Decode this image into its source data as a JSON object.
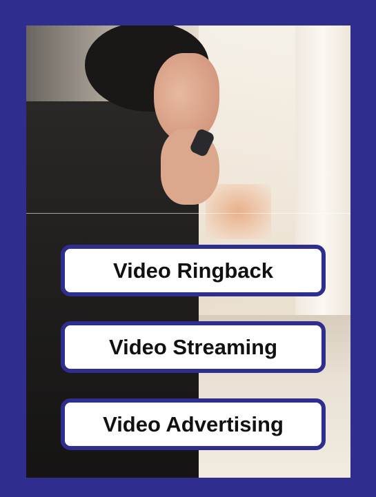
{
  "colors": {
    "frame": "#2f2e8f",
    "badge_bg": "#ffffff",
    "badge_text": "#111111"
  },
  "photo": {
    "subject": "woman-on-phone-photo"
  },
  "badges": [
    {
      "label": "Video Ringback"
    },
    {
      "label": "Video Streaming"
    },
    {
      "label": "Video Advertising"
    }
  ]
}
